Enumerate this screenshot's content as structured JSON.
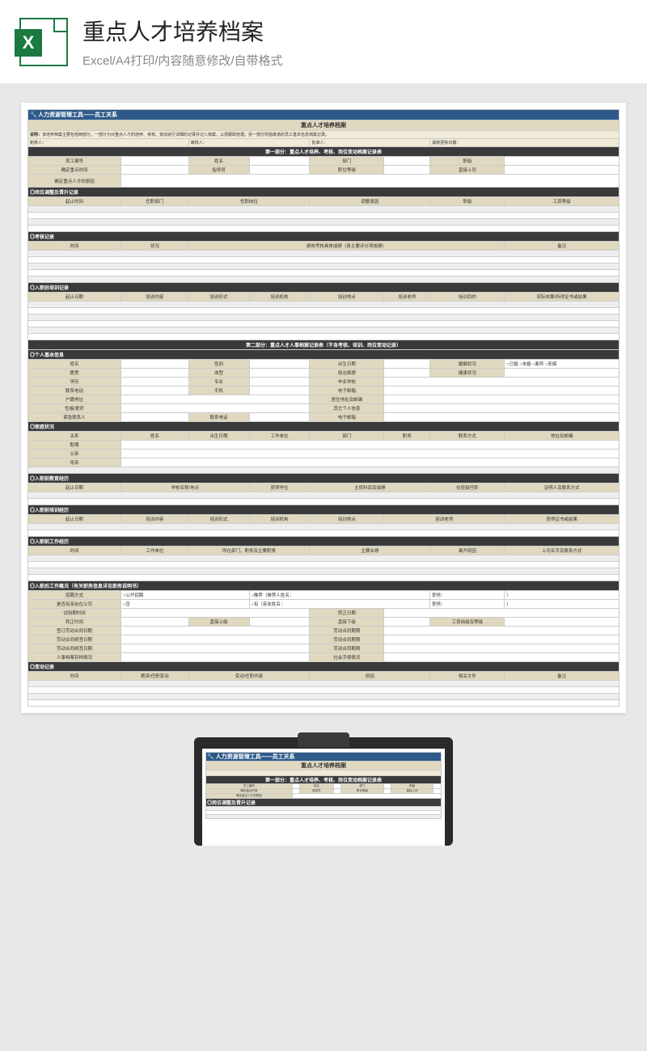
{
  "header": {
    "title": "重点人才培养档案",
    "subtitle": "Excel/A4打印/内容随意修改/自带格式"
  },
  "doc": {
    "banner": "人力资源管理工具——员工关系",
    "title": "重点人才培养档案",
    "note_label": "说明：",
    "note": "该培养档案主要包括两部分，一部分为对重点人才的培养、考核、变动进行详细的记录并记入档案，以便跟踪管理；另一部分则指离谱的员工基本信息档案记录。",
    "row_filler": [
      "制表人：",
      "审核人：",
      "批准人：",
      "最新更新日期："
    ],
    "part1_title": "第一部分：重点人才培养、考核、岗位变动档案记录表",
    "basic1": {
      "r1": [
        "员工编号",
        "姓名",
        "部门",
        "职级"
      ],
      "r2": [
        "确定重点时间",
        "指导员",
        "职位等级",
        "直接上司"
      ],
      "r3": "确定重点人才的原因"
    },
    "sec_pos": {
      "hd": "◎岗位调整及晋升记录",
      "cols": [
        "起止时间",
        "任职部门",
        "任职岗位",
        "调整原因",
        "职级",
        "工资等级"
      ]
    },
    "sec_exam": {
      "hd": "◎考核记录",
      "cols": [
        "时间",
        "状况",
        "绩效考核具体成绩（各主要评分项成绩）",
        "备注"
      ]
    },
    "sec_train_after": {
      "hd": "◎入职后培训记录",
      "cols": [
        "起止日期",
        "培训内容",
        "培训形式",
        "培训机构",
        "培训地点",
        "培训老师",
        "培训目的",
        "实际效果/所得证书或结果"
      ]
    },
    "part2_title": "第二部分：重点人才人事档案记录表（不含考核、培训、岗位变动记录）",
    "sec_personal": {
      "hd": "◎个人基本信息",
      "rows": [
        [
          "姓名",
          "性别",
          "出生日期",
          "婚姻状况",
          "○已婚  ○未婚  ○离异  ○丧偶"
        ],
        [
          "籍贯",
          "血型",
          "政治面貌",
          "健康状况",
          ""
        ],
        [
          "学历",
          "专业",
          "毕业学校",
          "",
          ""
        ],
        [
          "联系电话",
          "手机",
          "电子邮箱",
          "",
          ""
        ],
        [
          "户籍地址",
          "",
          "居住地址及邮编",
          "",
          ""
        ],
        [
          "性格/爱好",
          "",
          "其它个人信息",
          "",
          ""
        ],
        [
          "紧急联系人",
          "联系电话",
          "电子邮箱",
          "",
          ""
        ]
      ]
    },
    "sec_family": {
      "hd": "◎家庭状况",
      "cols": [
        "关系",
        "姓名",
        "出生日期",
        "工作单位",
        "部门",
        "职务",
        "联系方式",
        "地址及邮编"
      ],
      "rel": [
        "配偶",
        "父亲",
        "母亲"
      ]
    },
    "sec_edu": {
      "hd": "◎入职前教育经历",
      "cols": [
        "起止日期",
        "学校名称/地点",
        "获得学位",
        "主修科目及成绩",
        "在班级任职",
        "证明人及联系方式"
      ]
    },
    "sec_train_before": {
      "hd": "◎入职前培训经历",
      "cols": [
        "起止日期",
        "培训内容",
        "培训形式",
        "培训机构",
        "培训地点",
        "培训老师",
        "获得证书或结果"
      ]
    },
    "sec_work": {
      "hd": "◎入职前工作经历",
      "cols": [
        "时间",
        "工作单位",
        "所在部门、职务及主要职责",
        "主要业绩",
        "离开原因",
        "上司名字及联系方式"
      ]
    },
    "sec_hire": {
      "hd": "◎入职后工作概况（有关职务信息详见职务说明书）",
      "rows": [
        [
          "招聘方式",
          "○公开招聘",
          "○推荐（推荐人姓名：",
          "职务：",
          "）"
        ],
        [
          "是否有亲友在公司",
          "○否",
          "○有（亲友姓名：",
          "职务：",
          "）"
        ],
        [
          "试用期时间",
          "",
          "转正日期",
          "",
          ""
        ],
        [
          "转正时间",
          "直接上级",
          "直接下级",
          "工资岗级及等级",
          ""
        ],
        [
          "签订劳动合同日期",
          "",
          "劳动合同期限",
          "",
          ""
        ],
        [
          "劳动合同续签日期",
          "",
          "劳动合同期限",
          "",
          ""
        ],
        [
          "劳动合同续签日期",
          "",
          "劳动合同期限",
          "",
          ""
        ],
        [
          "人事档案存档情况",
          "",
          "社会手续情况",
          "",
          ""
        ]
      ]
    },
    "sec_change": {
      "hd": "◎变动记录",
      "cols": [
        "时间",
        "薪资/任职变动",
        "变动/任职内容",
        "原因",
        "相关文件",
        "备注"
      ]
    }
  }
}
